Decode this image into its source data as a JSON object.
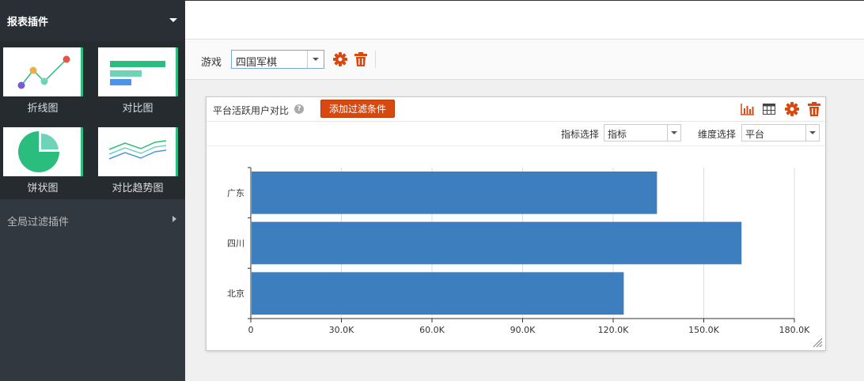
{
  "sidebar": {
    "header": "报表插件",
    "tiles": [
      {
        "label": "折线图",
        "icon": "line-chart-icon"
      },
      {
        "label": "对比图",
        "icon": "bar-compare-icon"
      },
      {
        "label": "饼状图",
        "icon": "pie-chart-icon"
      },
      {
        "label": "对比趋势图",
        "icon": "trend-compare-icon"
      }
    ],
    "global_filter": "全局过滤插件"
  },
  "filterbar": {
    "label": "游戏",
    "game_value": "四国军棋"
  },
  "panel": {
    "title": "平台活跃用户对比",
    "add_filter": "添加过滤条件",
    "metric_label": "指标选择",
    "metric_value": "指标",
    "dimension_label": "维度选择",
    "dimension_value": "平台"
  },
  "colors": {
    "accent": "#d9480f",
    "bar": "#3d7ebf",
    "sidebar": "#323840"
  },
  "chart_data": {
    "type": "bar",
    "orientation": "horizontal",
    "categories": [
      "广东",
      "四川",
      "北京"
    ],
    "values": [
      134500,
      162500,
      123500
    ],
    "xlim": [
      0,
      180000
    ],
    "xticks": [
      0,
      30000,
      60000,
      90000,
      120000,
      150000,
      180000
    ],
    "xtick_labels": [
      "0",
      "30.0K",
      "60.0K",
      "90.0K",
      "120.0K",
      "150.0K",
      "180.0K"
    ],
    "grid": true,
    "title": "",
    "xlabel": "",
    "ylabel": ""
  }
}
